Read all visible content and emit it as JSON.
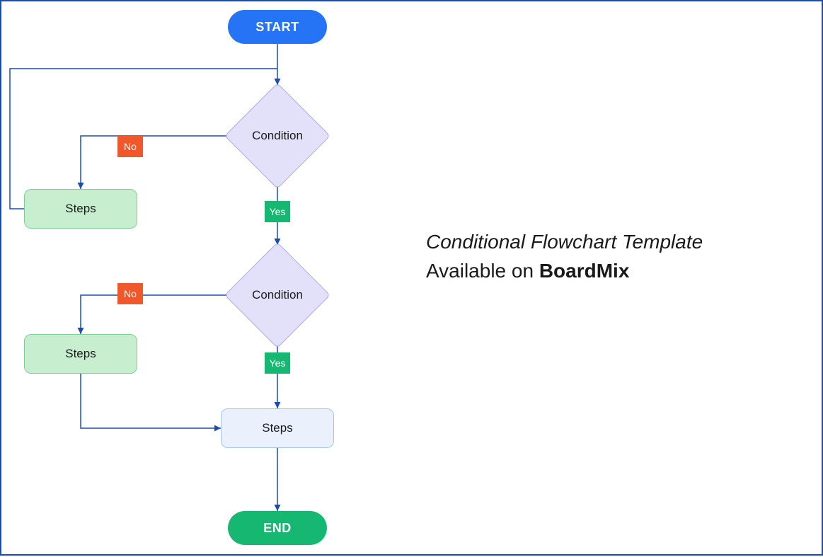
{
  "flowchart": {
    "start": "START",
    "condition1": "Condition",
    "condition2": "Condition",
    "steps1": "Steps",
    "steps2": "Steps",
    "steps3": "Steps",
    "end": "END",
    "labelNo": "No",
    "labelYes": "Yes"
  },
  "caption": {
    "title": "Conditional Flowchart Template",
    "availablePrefix": "Available on ",
    "brand": "BoardMix"
  },
  "colors": {
    "start": "#2574f5",
    "end": "#16b770",
    "diamond": "#e3e0f9",
    "processGreen": "#c7efcf",
    "processBlue": "#eaf1fc",
    "tagNo": "#f0582b",
    "tagYes": "#16b770",
    "connector": "#1a4db3",
    "border": "#1a4db3"
  }
}
